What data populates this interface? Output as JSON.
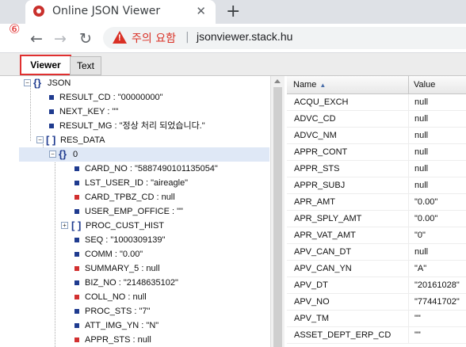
{
  "browser": {
    "tab_title": "Online JSON Viewer",
    "new_tab": "+",
    "close": "✕",
    "step_badge": "⑥",
    "security_text": "주의 요함",
    "separator": "|",
    "url": "jsonviewer.stack.hu"
  },
  "viewer_tabs": {
    "viewer": "Viewer",
    "text": "Text"
  },
  "tree": {
    "root": "JSON",
    "result_cd": "RESULT_CD : \"00000000\"",
    "next_key": "NEXT_KEY : \"\"",
    "result_mg": "RESULT_MG : \"정상 처리 되었습니다.\"",
    "res_data": "RES_DATA",
    "index0": "0",
    "children": [
      {
        "text": "CARD_NO : \"5887490101135054\"",
        "color": "#1f3b8f"
      },
      {
        "text": "LST_USER_ID : \"aireagle\"",
        "color": "#1f3b8f"
      },
      {
        "text": "CARD_TPBZ_CD : null",
        "color": "#d23030"
      },
      {
        "text": "USER_EMP_OFFICE : \"\"",
        "color": "#1f3b8f"
      },
      {
        "text": "PROC_CUST_HIST",
        "color": "#1f3b8f"
      },
      {
        "text": "SEQ : \"1000309139\"",
        "color": "#1f3b8f"
      },
      {
        "text": "COMM : \"0.00\"",
        "color": "#1f3b8f"
      },
      {
        "text": "SUMMARY_5 : null",
        "color": "#d23030"
      },
      {
        "text": "BIZ_NO : \"2148635102\"",
        "color": "#1f3b8f"
      },
      {
        "text": "COLL_NO : null",
        "color": "#d23030"
      },
      {
        "text": "PROC_STS : \"7\"",
        "color": "#1f3b8f"
      },
      {
        "text": "ATT_IMG_YN : \"N\"",
        "color": "#1f3b8f"
      },
      {
        "text": "APPR_STS : null",
        "color": "#d23030"
      }
    ]
  },
  "grid": {
    "col_name": "Name",
    "col_value": "Value",
    "rows": [
      [
        "ACQU_EXCH",
        "null"
      ],
      [
        "ADVC_CD",
        "null"
      ],
      [
        "ADVC_NM",
        "null"
      ],
      [
        "APPR_CONT",
        "null"
      ],
      [
        "APPR_STS",
        "null"
      ],
      [
        "APPR_SUBJ",
        "null"
      ],
      [
        "APR_AMT",
        "\"0.00\""
      ],
      [
        "APR_SPLY_AMT",
        "\"0.00\""
      ],
      [
        "APR_VAT_AMT",
        "\"0\""
      ],
      [
        "APV_CAN_DT",
        "null"
      ],
      [
        "APV_CAN_YN",
        "\"A\""
      ],
      [
        "APV_DT",
        "\"20161028\""
      ],
      [
        "APV_NO",
        "\"77441702\""
      ],
      [
        "APV_TM",
        "\"\""
      ],
      [
        "ASSET_DEPT_ERP_CD",
        "\"\""
      ]
    ]
  }
}
